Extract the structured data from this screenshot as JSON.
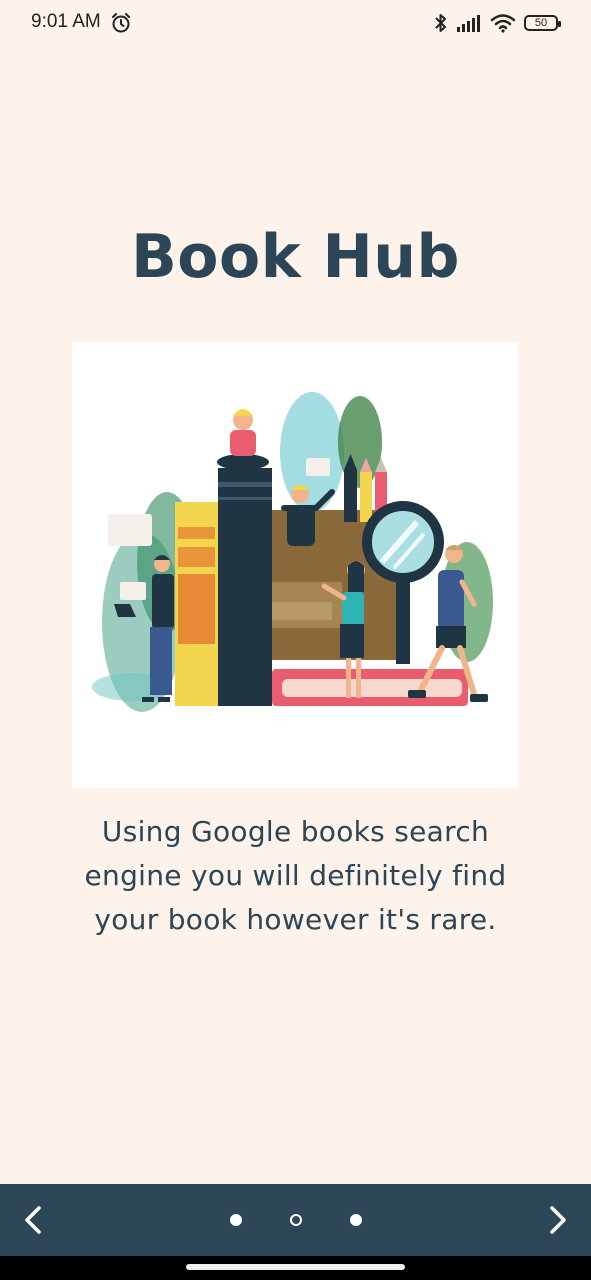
{
  "status_bar": {
    "time": "9:01 AM",
    "battery": "50",
    "icons": [
      "alarm-icon",
      "bluetooth-icon",
      "signal-icon",
      "wifi-icon",
      "battery-icon"
    ]
  },
  "screen": {
    "title": "Book Hub",
    "description": "Using Google books search engine you will definitely find your book however it's rare.",
    "illustration": "books-reading-people-illustration"
  },
  "navigation": {
    "prev_icon": "chevron-left-icon",
    "next_icon": "chevron-right-icon",
    "page_count": 3,
    "current_page": 2
  },
  "colors": {
    "background": "#fdf3ea",
    "primary": "#2d4658",
    "text": "#2c4557"
  }
}
